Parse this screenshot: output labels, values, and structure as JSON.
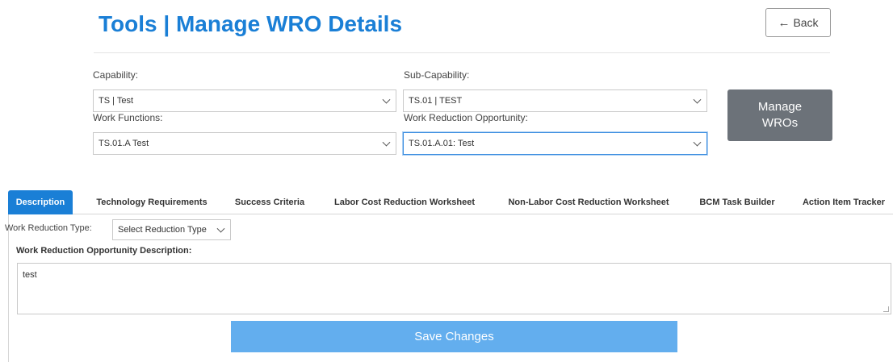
{
  "page": {
    "title": "Tools | Manage WRO Details",
    "back_label": "Back"
  },
  "filters": {
    "capability": {
      "label": "Capability:",
      "value": "TS | Test"
    },
    "sub_capability": {
      "label": "Sub-Capability:",
      "value": "TS.01 | TEST"
    },
    "work_functions": {
      "label": "Work Functions:",
      "value": "TS.01.A Test"
    },
    "wro": {
      "label": "Work Reduction Opportunity:",
      "value": "TS.01.A.01: Test"
    },
    "manage_button": "Manage WROs"
  },
  "tabs": [
    {
      "label": "Description",
      "active": true
    },
    {
      "label": "Technology Requirements"
    },
    {
      "label": "Success Criteria"
    },
    {
      "label": "Labor Cost Reduction Worksheet"
    },
    {
      "label": "Non-Labor Cost Reduction Worksheet"
    },
    {
      "label": "BCM Task Builder"
    },
    {
      "label": "Action Item Tracker"
    }
  ],
  "description_tab": {
    "reduction_type_label": "Work Reduction Type:",
    "reduction_type_value": "Select Reduction Type",
    "description_label": "Work Reduction Opportunity Description:",
    "description_value": "test",
    "save_label": "Save Changes"
  },
  "colors": {
    "accent": "#1a7fd6",
    "manage_button": "#6c7279",
    "save_button": "#63aeee"
  }
}
